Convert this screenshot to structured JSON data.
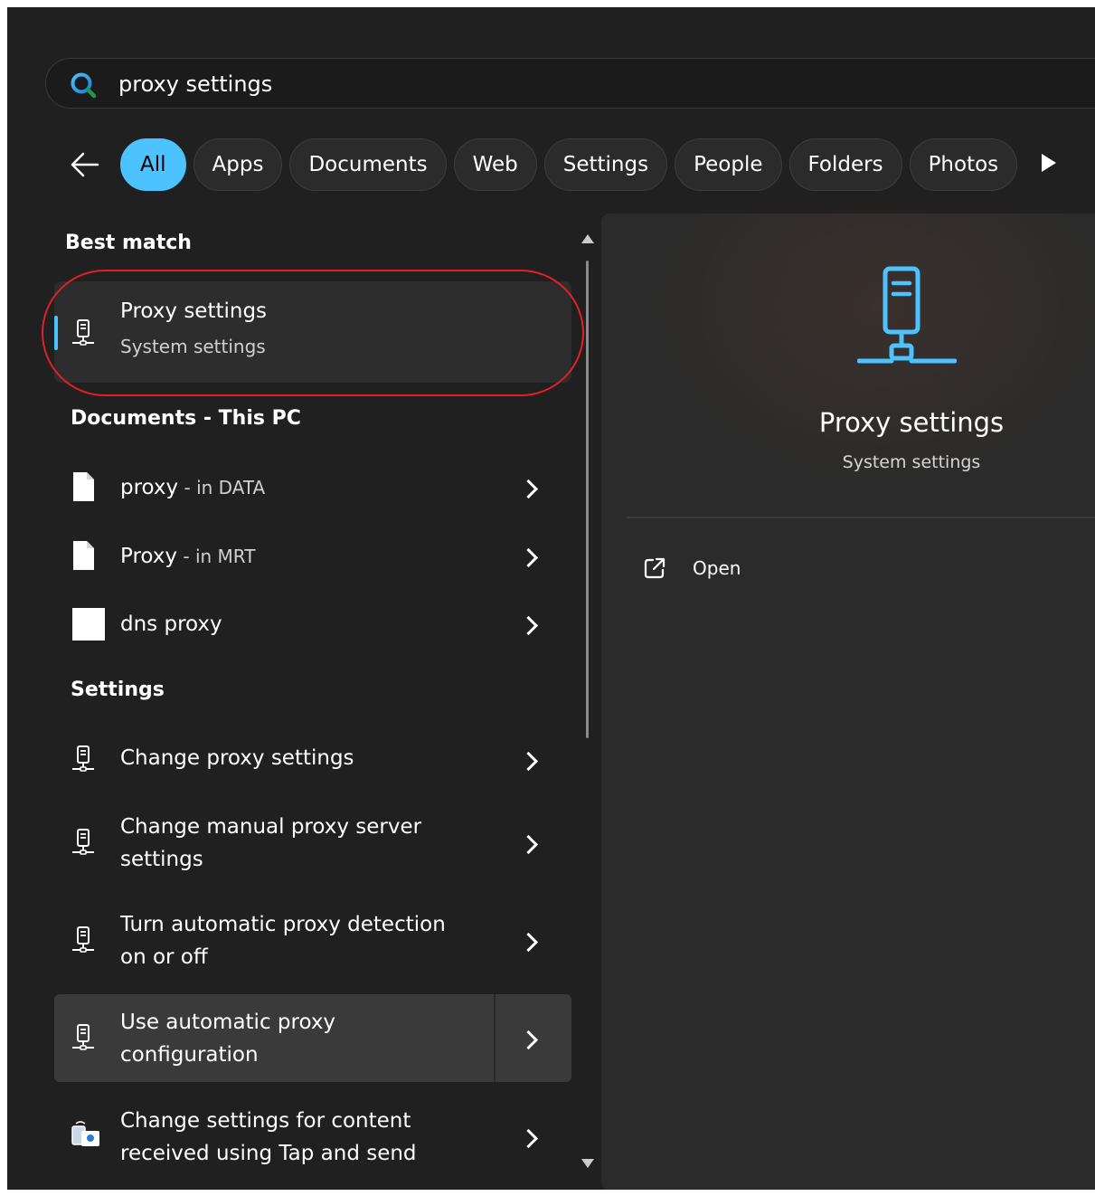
{
  "search": {
    "query": "proxy settings"
  },
  "filters": {
    "chips": [
      "All",
      "Apps",
      "Documents",
      "Web",
      "Settings",
      "People",
      "Folders",
      "Photos"
    ],
    "active": "All"
  },
  "best_match": {
    "heading": "Best match",
    "title": "Proxy settings",
    "subtitle": "System settings"
  },
  "documents": {
    "heading": "Documents - This PC",
    "items": [
      {
        "name": "proxy",
        "location": " - in DATA"
      },
      {
        "name": "Proxy",
        "location": " - in MRT"
      },
      {
        "name": "dns proxy",
        "location": ""
      }
    ]
  },
  "settings": {
    "heading": "Settings",
    "items": [
      {
        "line1": "Change proxy settings",
        "line2": ""
      },
      {
        "line1": "Change manual proxy server",
        "line2": "settings"
      },
      {
        "line1": "Turn automatic proxy detection",
        "line2": "on or off"
      },
      {
        "line1": "Use automatic proxy",
        "line2": "configuration"
      },
      {
        "line1": "Change settings for content",
        "line2": "received using Tap and send"
      }
    ]
  },
  "preview": {
    "title": "Proxy settings",
    "subtitle": "System settings",
    "open_label": "Open"
  },
  "colors": {
    "accent": "#4cc2ff",
    "highlight": "#e0202a",
    "background": "#202020"
  }
}
